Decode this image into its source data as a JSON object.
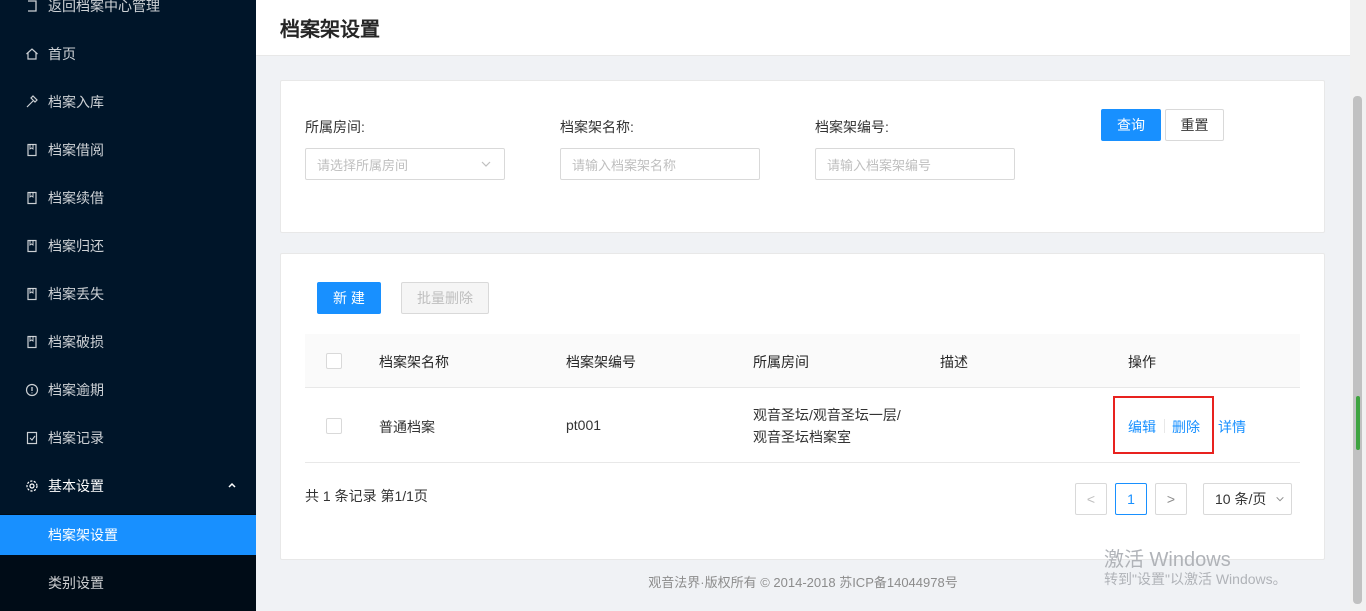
{
  "sidebar": {
    "back": "返回档案中心管理",
    "items": [
      {
        "label": "首页",
        "icon": "home-icon"
      },
      {
        "label": "档案入库",
        "icon": "hammer-icon"
      },
      {
        "label": "档案借阅",
        "icon": "book-icon"
      },
      {
        "label": "档案续借",
        "icon": "book-icon"
      },
      {
        "label": "档案归还",
        "icon": "book-icon"
      },
      {
        "label": "档案丢失",
        "icon": "book-icon"
      },
      {
        "label": "档案破损",
        "icon": "book-icon"
      },
      {
        "label": "档案逾期",
        "icon": "alert-circle-icon"
      },
      {
        "label": "档案记录",
        "icon": "record-icon"
      }
    ],
    "group": {
      "label": "基本设置",
      "icon": "gear-icon"
    },
    "sub_items": [
      {
        "label": "档案架设置",
        "active": true
      },
      {
        "label": "类别设置",
        "active": false
      }
    ]
  },
  "header": {
    "title": "档案架设置"
  },
  "filter": {
    "room_label": "所属房间:",
    "room_placeholder": "请选择所属房间",
    "name_label": "档案架名称:",
    "name_placeholder": "请输入档案架名称",
    "code_label": "档案架编号:",
    "code_placeholder": "请输入档案架编号",
    "query_label": "查询",
    "reset_label": "重置"
  },
  "toolbar": {
    "new_label": "新 建",
    "batch_delete_label": "批量删除"
  },
  "table": {
    "columns": [
      "档案架名称",
      "档案架编号",
      "所属房间",
      "描述",
      "操作"
    ],
    "rows": [
      {
        "name": "普通档案",
        "code": "pt001",
        "room_line1": "观音圣坛/观音圣坛一层/",
        "room_line2": "观音圣坛档案室",
        "desc": "",
        "edit": "编辑",
        "delete": "删除",
        "detail": "详情"
      }
    ]
  },
  "pagination": {
    "summary": "共 1 条记录 第1/1页",
    "current": "1",
    "prev": "<",
    "next": ">",
    "page_size": "10 条/页"
  },
  "footer": {
    "copyright": "观音法界·版权所有 © 2014-2018 苏ICP备14044978号"
  },
  "watermark": {
    "line1": "激活 Windows",
    "line2": "转到\"设置\"以激活 Windows。"
  },
  "colors": {
    "sidebar_bg": "#001529",
    "primary": "#1890ff",
    "highlight": "#e8221f"
  }
}
